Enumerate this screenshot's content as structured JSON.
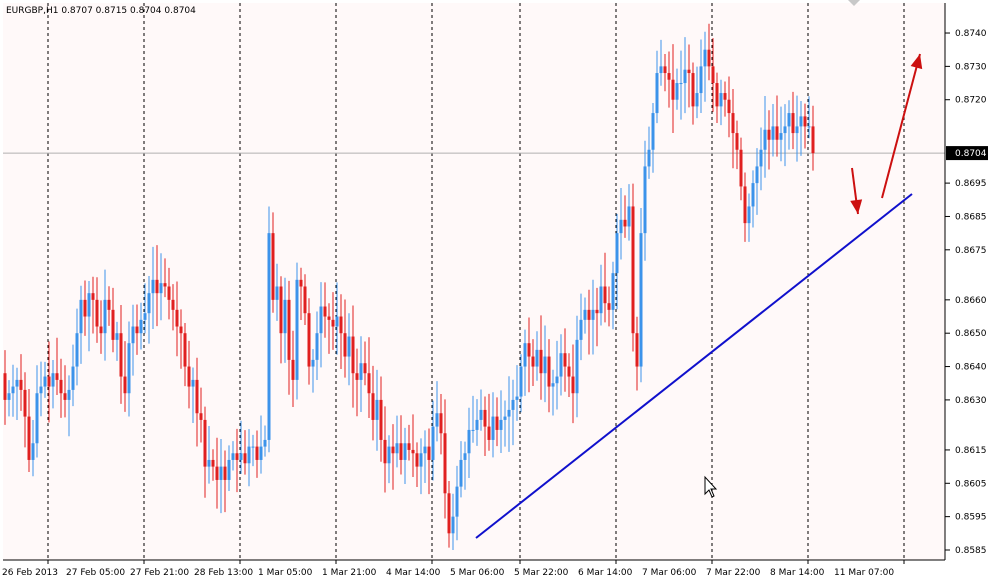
{
  "header": {
    "symbol_line": "EURGBP,H1  0.8707 0.8715 0.8704 0.8704"
  },
  "colors": {
    "background": "#fff9f9",
    "bull": "#3c93ea",
    "bear": "#e02020",
    "trendline": "#1010cc",
    "arrow": "#cc1010",
    "grid": "#000000",
    "price_line": "#b0b0b0"
  },
  "chart_data": {
    "type": "candlestick",
    "symbol": "EURGBP",
    "timeframe": "H1",
    "ohlc_header": {
      "open": 0.8707,
      "high": 0.8715,
      "low": 0.8704,
      "close": 0.8704
    },
    "current_price": "0.8704",
    "ylim": [
      0.8582,
      0.8749
    ],
    "y_ticks": [
      "0.8740",
      "0.8730",
      "0.8720",
      "0.8704",
      "0.8695",
      "0.8685",
      "0.8675",
      "0.8660",
      "0.8650",
      "0.8640",
      "0.8630",
      "0.8615",
      "0.8605",
      "0.8595",
      "0.8585"
    ],
    "x_ticks": [
      "26 Feb 2013",
      "27 Feb 05:00",
      "27 Feb 21:00",
      "28 Feb 13:00",
      "1 Mar 05:00",
      "1 Mar 21:00",
      "4 Mar 14:00",
      "5 Mar 06:00",
      "5 Mar 22:00",
      "6 Mar 14:00",
      "7 Mar 06:00",
      "7 Mar 22:00",
      "8 Mar 14:00",
      "11 Mar 07:00"
    ],
    "candles_close": [
      0.863,
      0.8632,
      0.8634,
      0.8636,
      0.8633,
      0.8625,
      0.8612,
      0.8617,
      0.8632,
      0.8634,
      0.8637,
      0.8634,
      0.8638,
      0.8636,
      0.8632,
      0.863,
      0.8633,
      0.864,
      0.865,
      0.866,
      0.8655,
      0.8662,
      0.866,
      0.8652,
      0.865,
      0.866,
      0.8657,
      0.8648,
      0.865,
      0.8637,
      0.8632,
      0.8647,
      0.8652,
      0.865,
      0.8654,
      0.8656,
      0.8662,
      0.8666,
      0.8662,
      0.8665,
      0.8664,
      0.866,
      0.8657,
      0.8652,
      0.865,
      0.864,
      0.8634,
      0.8636,
      0.8626,
      0.8624,
      0.861,
      0.8612,
      0.861,
      0.8606,
      0.861,
      0.8606,
      0.8612,
      0.8614,
      0.8612,
      0.8614,
      0.8611,
      0.8616,
      0.8616,
      0.8612,
      0.8616,
      0.8618,
      0.868,
      0.866,
      0.8664,
      0.865,
      0.866,
      0.8642,
      0.8636,
      0.8666,
      0.8664,
      0.8656,
      0.864,
      0.8642,
      0.865,
      0.8658,
      0.8655,
      0.8654,
      0.8652,
      0.8655,
      0.865,
      0.8643,
      0.8649,
      0.8638,
      0.8636,
      0.8641,
      0.8638,
      0.8632,
      0.8624,
      0.863,
      0.8618,
      0.8611,
      0.8616,
      0.8614,
      0.8617,
      0.8612,
      0.8617,
      0.8615,
      0.8614,
      0.861,
      0.8614,
      0.8616,
      0.8612,
      0.8622,
      0.8626,
      0.862,
      0.8602,
      0.859,
      0.8595,
      0.8604,
      0.8612,
      0.8614,
      0.8621,
      0.8621,
      0.8624,
      0.8627,
      0.8622,
      0.8618,
      0.8625,
      0.8621,
      0.8624,
      0.8625,
      0.8627,
      0.863,
      0.8631,
      0.864,
      0.8647,
      0.8643,
      0.864,
      0.8645,
      0.8638,
      0.8643,
      0.8634,
      0.8635,
      0.8637,
      0.8644,
      0.864,
      0.8637,
      0.8632,
      0.8648,
      0.8654,
      0.8657,
      0.8654,
      0.8657,
      0.8656,
      0.8664,
      0.8659,
      0.8657,
      0.8668,
      0.868,
      0.8684,
      0.8682,
      0.8688,
      0.865,
      0.864,
      0.868,
      0.87,
      0.8705,
      0.8716,
      0.8728,
      0.873,
      0.8728,
      0.8726,
      0.872,
      0.8725,
      0.8725,
      0.8729,
      0.8728,
      0.8718,
      0.8722,
      0.873,
      0.8735,
      0.873,
      0.8725,
      0.8718,
      0.8722,
      0.872,
      0.8716,
      0.871,
      0.8705,
      0.8694,
      0.8683,
      0.8688,
      0.8695,
      0.87,
      0.8705,
      0.8711,
      0.8708,
      0.8712,
      0.8708,
      0.871,
      0.8712,
      0.8716,
      0.871,
      0.8712,
      0.8715,
      0.8712,
      0.8712,
      0.8704
    ],
    "x_lines": [
      {
        "name": "trendline",
        "from_index": 127,
        "to_index": 243,
        "from_price": 0.8588,
        "to_price": 0.8695
      }
    ],
    "grid": "vertical dashed",
    "annotations": [
      "blue ascending trendline",
      "red down arrow",
      "red up arrow"
    ]
  }
}
